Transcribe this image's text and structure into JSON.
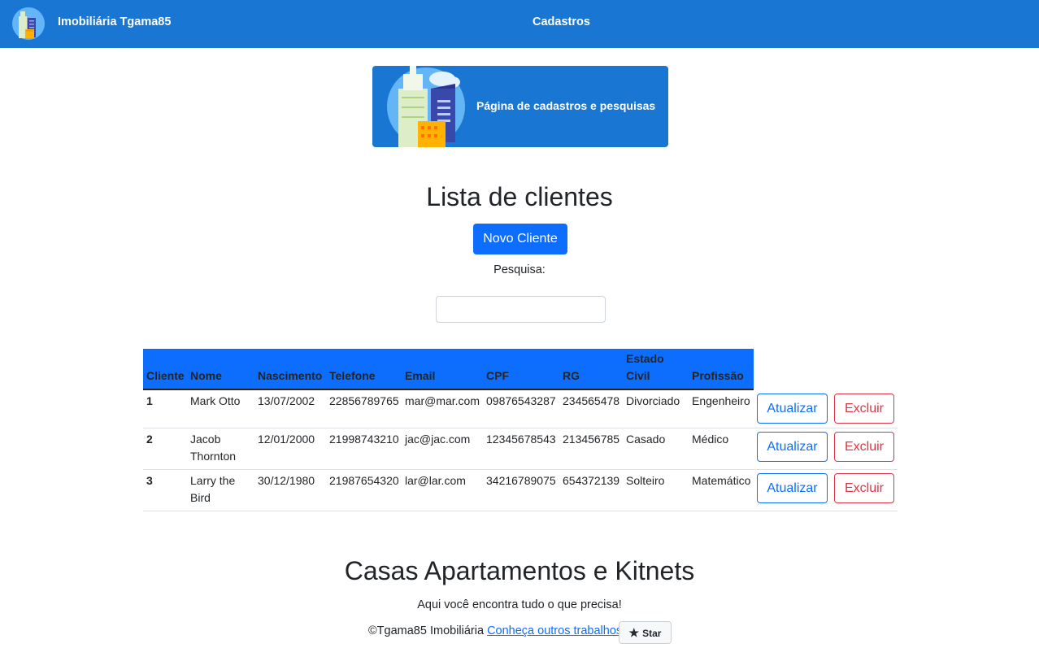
{
  "nav": {
    "brand": "Imobiliária Tgama85",
    "link": "Cadastros"
  },
  "banner": {
    "text": "Página de cadastros e pesquisas"
  },
  "main": {
    "title": "Lista de clientes",
    "new_button": "Novo Cliente",
    "search_label": "Pesquisa:",
    "search_value": ""
  },
  "table": {
    "headers": {
      "cliente": "Cliente",
      "nome": "Nome",
      "nascimento": "Nascimento",
      "telefone": "Telefone",
      "email": "Email",
      "cpf": "CPF",
      "rg": "RG",
      "estado_civil_1": "Estado",
      "estado_civil_2": "Civil",
      "profissao": "Profissão"
    },
    "rows": [
      {
        "id": "1",
        "nome_1": "Mark Otto",
        "nome_2": "",
        "nascimento": "13/07/2002",
        "telefone": "22856789765",
        "email": "mar@mar.com",
        "cpf": "09876543287",
        "rg": "234565478",
        "estado_civil": "Divorciado",
        "profissao": "Engenheiro"
      },
      {
        "id": "2",
        "nome_1": "Jacob",
        "nome_2": "Thornton",
        "nascimento": "12/01/2000",
        "telefone": "21998743210",
        "email": "jac@jac.com",
        "cpf": "12345678543",
        "rg": "213456785",
        "estado_civil": "Casado",
        "profissao": "Médico"
      },
      {
        "id": "3",
        "nome_1": "Larry the",
        "nome_2": "Bird",
        "nascimento": "30/12/1980",
        "telefone": "21987654320",
        "email": "lar@lar.com",
        "cpf": "34216789075",
        "rg": "654372139",
        "estado_civil": "Solteiro",
        "profissao": "Matemático"
      }
    ],
    "update_label": "Atualizar",
    "delete_label": "Excluir"
  },
  "footer": {
    "title": "Casas Apartamentos e Kitnets",
    "subtitle": "Aqui você encontra tudo o que precisa!",
    "copyright": "©Tgama85 Imobiliária ",
    "link": "Conheça outros trabalhos.",
    "star_label": "Star"
  },
  "colors": {
    "navbar": "#1976d2",
    "primary": "#0d6efd",
    "danger": "#dc3545"
  },
  "icons": {
    "logo": "city-buildings-icon",
    "star": "star-icon"
  }
}
